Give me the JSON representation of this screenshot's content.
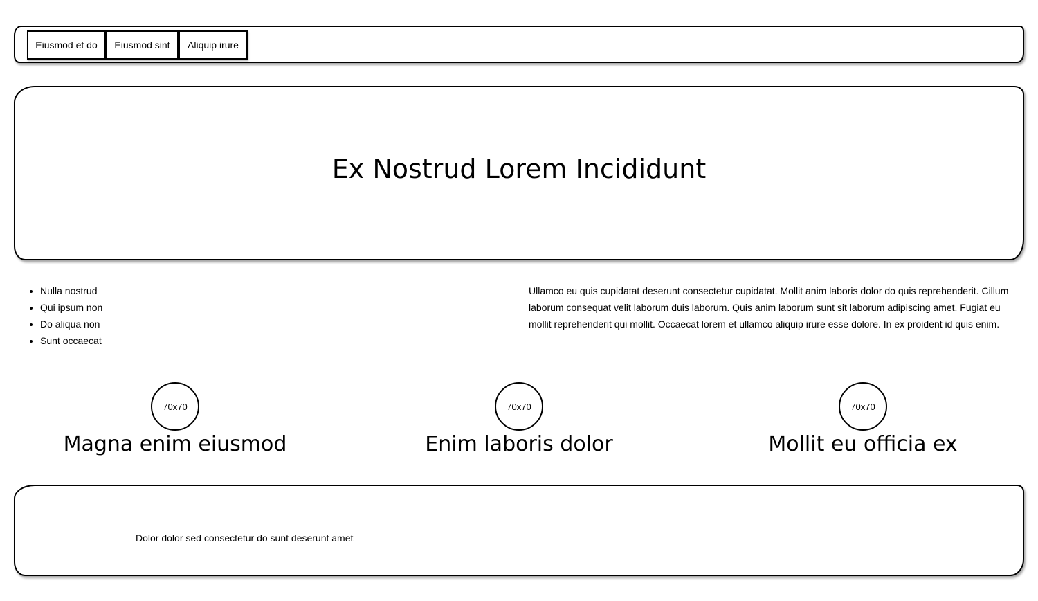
{
  "nav": {
    "tabs": [
      {
        "label": "Eiusmod et do"
      },
      {
        "label": "Eiusmod sint"
      },
      {
        "label": "Aliquip irure"
      }
    ]
  },
  "hero": {
    "title": "Ex Nostrud Lorem Incididunt"
  },
  "list": {
    "items": [
      "Nulla nostrud",
      "Qui ipsum non",
      "Do aliqua non",
      "Sunt occaecat"
    ]
  },
  "paragraph": {
    "text": "Ullamco eu quis cupidatat deserunt consectetur cupidatat. Mollit anim laboris dolor do quis reprehenderit. Cillum laborum consequat velit laborum duis laborum. Quis anim laborum sunt sit laborum adipiscing amet. Fugiat eu mollit reprehenderit qui mollit. Occaecat lorem et ullamco aliquip irure esse dolore. In ex proident id quis enim."
  },
  "features": [
    {
      "image_label": "70x70",
      "title": "Magna enim eiusmod"
    },
    {
      "image_label": "70x70",
      "title": "Enim laboris dolor"
    },
    {
      "image_label": "70x70",
      "title": "Mollit eu officia ex"
    }
  ],
  "footer": {
    "text": "Dolor dolor sed consectetur do sunt deserunt amet"
  }
}
